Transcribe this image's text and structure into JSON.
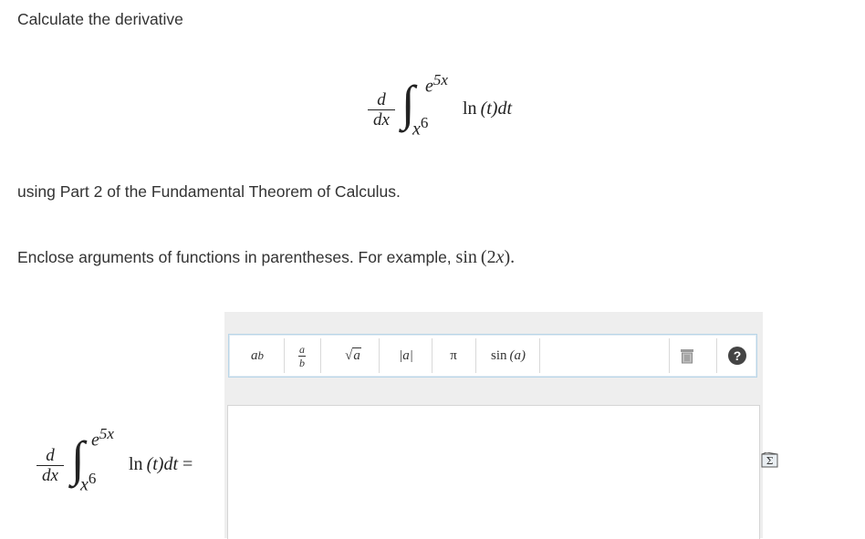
{
  "prompt": {
    "line1": "Calculate the derivative",
    "line2": "using Part 2 of the Fundamental Theorem of Calculus.",
    "line3_text": "Enclose arguments of functions in parentheses. For example, ",
    "line3_math_fn": "sin",
    "line3_math_arg": "(2",
    "line3_math_var": "x",
    "line3_math_close": ").",
    "line3_end": ""
  },
  "formula": {
    "d_num": "d",
    "d_den": "dx",
    "integral": "∫",
    "upper_base": "e",
    "upper_exp": "5x",
    "lower_base": "x",
    "lower_exp": "6",
    "integrand_fn": "ln",
    "integrand_arg": "(t)",
    "integrand_d": "dt",
    "equals": "="
  },
  "toolbar": {
    "power_base": "a",
    "power_exp": "b",
    "frac_num": "a",
    "frac_den": "b",
    "sqrt_sign": "√",
    "sqrt_arg": "a",
    "abs": "|a|",
    "pi": "π",
    "sin_fn": "sin",
    "sin_arg": "(a)",
    "help": "?"
  },
  "answer": {
    "value": ""
  },
  "colors": {
    "toolbar_border": "#b9d5e8",
    "panel_bg": "#eeeeee",
    "text": "#333333"
  }
}
